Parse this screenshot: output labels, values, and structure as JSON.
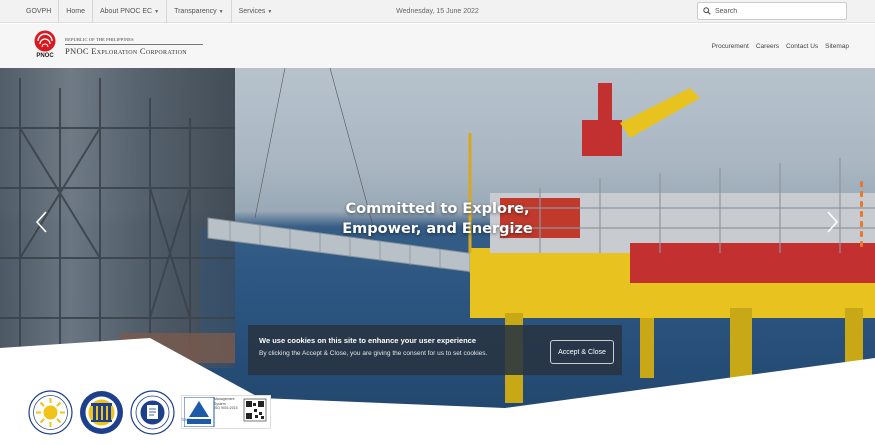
{
  "topbar": {
    "nav": [
      {
        "label": "GOVPH",
        "has_caret": false
      },
      {
        "label": "Home",
        "has_caret": false
      },
      {
        "label": "About PNOC EC",
        "has_caret": true
      },
      {
        "label": "Transparency",
        "has_caret": true
      },
      {
        "label": "Services",
        "has_caret": true
      }
    ],
    "date": "Wednesday, 15 June 2022",
    "search_placeholder": "Search"
  },
  "header": {
    "logo_abbrev": "PNOC",
    "logo_small": "Republic of the Philippines",
    "logo_name": "PNOC Exploration Corporation",
    "links": [
      "Procurement",
      "Careers",
      "Contact Us",
      "Sitemap"
    ]
  },
  "hero": {
    "title_line1": "Committed to Explore,",
    "title_line2": "Empower, and Energize"
  },
  "cookie": {
    "title": "We use cookies on this site to enhance your user experience",
    "text": "By clicking the Accept & Close, you are giving the consent for us to set cookies.",
    "button": "Accept & Close"
  },
  "seals": [
    {
      "name": "transparency-seal",
      "icon": "sun-seal-icon"
    },
    {
      "name": "government-seal",
      "icon": "pillars-seal-icon"
    },
    {
      "name": "foi-seal",
      "icon": "document-seal-icon"
    }
  ],
  "certification": {
    "brand": "TÜVRheinland",
    "lines": [
      "Management",
      "System",
      "ISO 9001:2015"
    ]
  },
  "colors": {
    "accent": "#e8782a",
    "pnoc_red": "#d71920",
    "topbar_bg": "#f2f2f2",
    "header_bg": "#f6f6f6"
  }
}
